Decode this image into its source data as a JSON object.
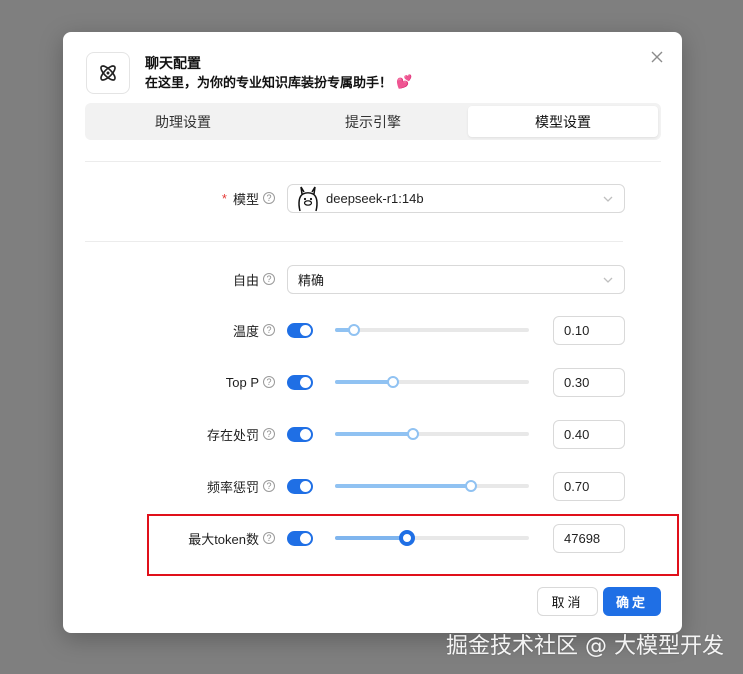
{
  "dialog": {
    "title": "聊天配置",
    "subtitle": "在这里，为你的专业知识库装扮专属助手！",
    "subtitle_emoji": "💕",
    "tabs": [
      {
        "label": "助理设置",
        "active": false
      },
      {
        "label": "提示引擎",
        "active": false
      },
      {
        "label": "模型设置",
        "active": true
      }
    ]
  },
  "form": {
    "model": {
      "label": "模型",
      "value": "deepseek-r1:14b",
      "required": true
    },
    "freedom": {
      "label": "自由",
      "value": "精确"
    },
    "params": [
      {
        "label": "温度",
        "enabled": true,
        "value": "0.10",
        "slider_fraction": 0.1
      },
      {
        "label": "Top P",
        "enabled": true,
        "value": "0.30",
        "slider_fraction": 0.3
      },
      {
        "label": "存在处罚",
        "enabled": true,
        "value": "0.40",
        "slider_fraction": 0.4
      },
      {
        "label": "频率惩罚",
        "enabled": true,
        "value": "0.70",
        "slider_fraction": 0.7
      },
      {
        "label": "最大token数",
        "enabled": true,
        "value": "47698",
        "slider_fraction": 0.37
      }
    ],
    "help_glyph": "?"
  },
  "footer": {
    "cancel_label": "取消",
    "ok_label": "确定"
  },
  "watermark": "掘金技术社区 @ 大模型开发",
  "colors": {
    "primary": "#1f6fe5",
    "slider_fill": "#90c2f2",
    "highlight": "#e0101a",
    "required": "#e53935"
  }
}
